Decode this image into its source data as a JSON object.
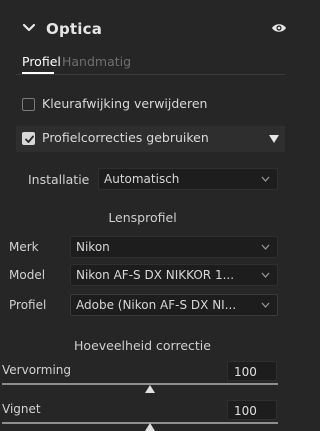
{
  "header": {
    "title": "Optica"
  },
  "tabs": [
    {
      "label": "Profiel"
    },
    {
      "label": "Handmatig"
    }
  ],
  "options": {
    "chromatic_label": "Kleurafwijking verwijderen",
    "chromatic_checked": false,
    "profile_label": "Profielcorrecties gebruiken",
    "profile_checked": true
  },
  "installatie": {
    "label": "Installatie",
    "value": "Automatisch"
  },
  "lensprofiel": {
    "title": "Lensprofiel",
    "merk_label": "Merk",
    "merk_value": "Nikon",
    "model_label": "Model",
    "model_value": "Nikon AF-S DX NIKKOR 1...",
    "profiel_label": "Profiel",
    "profiel_value": "Adobe (Nikon AF-S DX NI..."
  },
  "correctie": {
    "title": "Hoeveelheid correctie",
    "sliders": [
      {
        "label": "Vervorming",
        "value": "100"
      },
      {
        "label": "Vignet",
        "value": "100"
      }
    ]
  },
  "colors": {
    "panel_bg": "#262626",
    "field_bg": "#1d1d1d",
    "text": "#d7d7d7",
    "inactive": "#6f6f6f"
  }
}
